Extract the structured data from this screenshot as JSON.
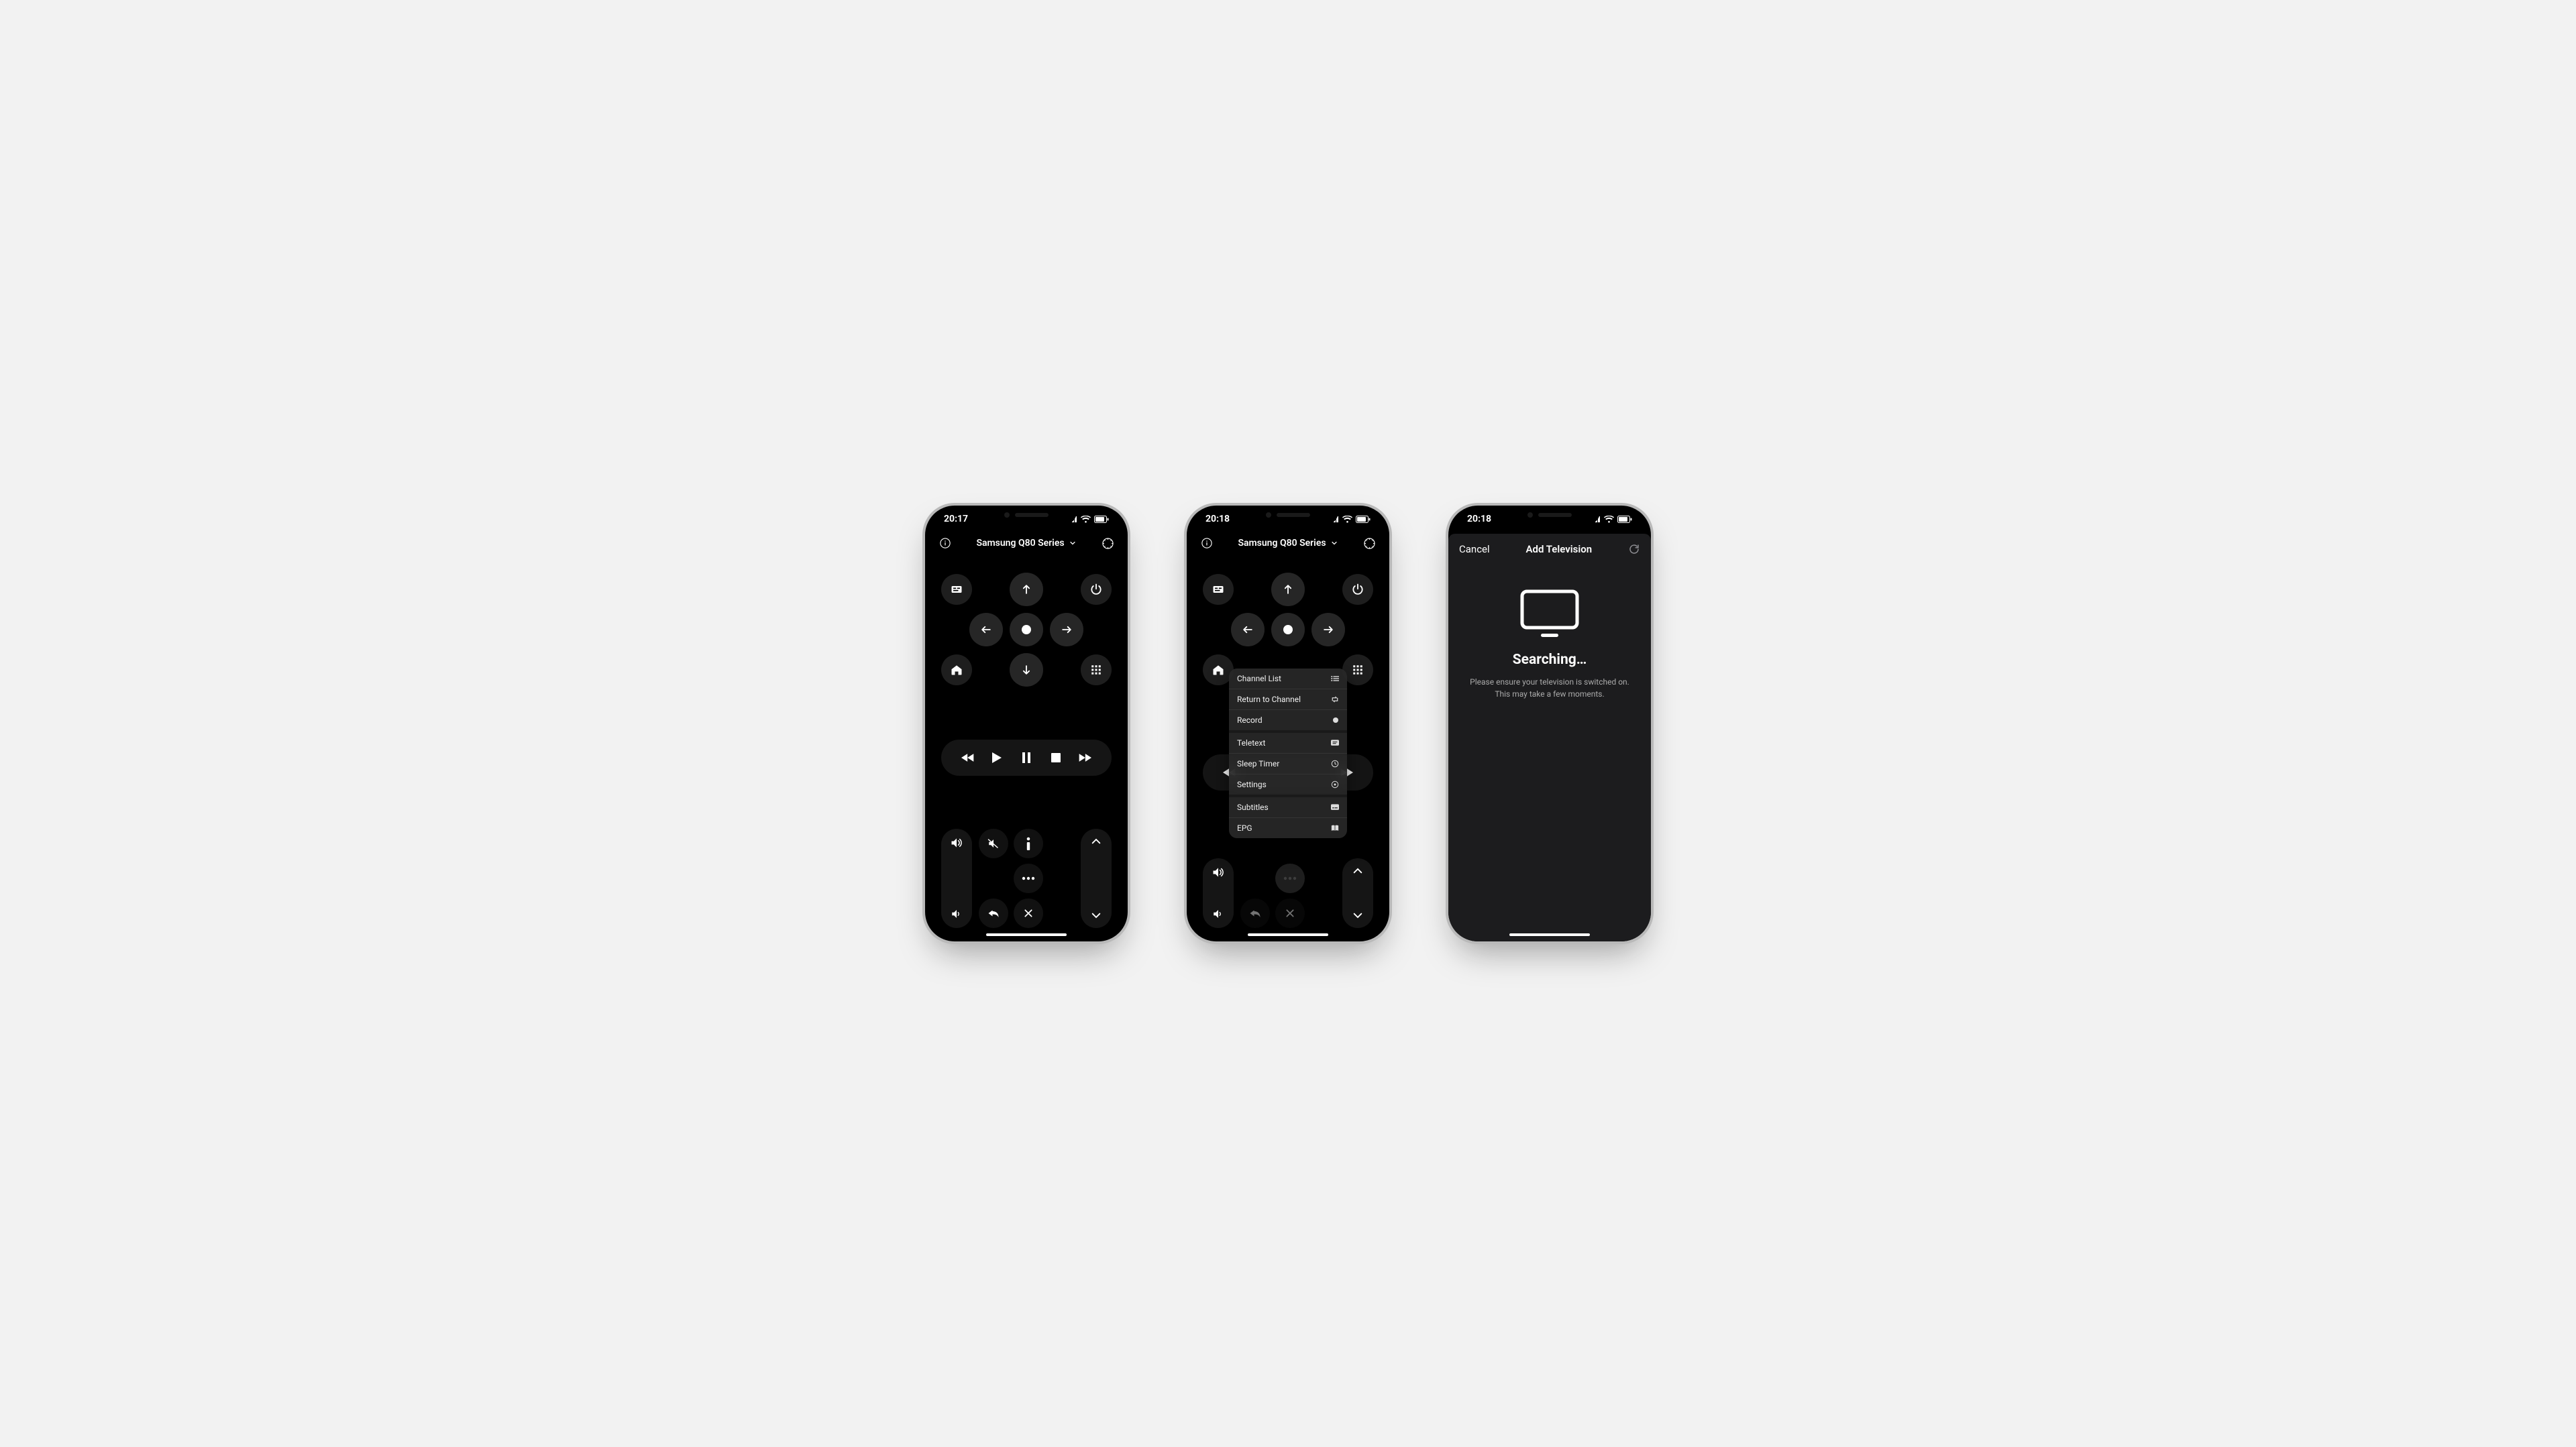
{
  "phones": [
    {
      "status_time": "20:17",
      "device_name": "Samsung Q80 Series",
      "menu_open": false
    },
    {
      "status_time": "20:18",
      "device_name": "Samsung Q80 Series",
      "menu_open": true,
      "menu": [
        {
          "label": "Channel List",
          "icon": "list-icon"
        },
        {
          "label": "Return to Channel",
          "icon": "swap-icon"
        },
        {
          "label": "Record",
          "icon": "record-dot-icon",
          "group_end": true
        },
        {
          "label": "Teletext",
          "icon": "teletext-icon"
        },
        {
          "label": "Sleep Timer",
          "icon": "clock-icon"
        },
        {
          "label": "Settings",
          "icon": "gear-icon",
          "group_end": true
        },
        {
          "label": "Subtitles",
          "icon": "subtitle-icon"
        },
        {
          "label": "EPG",
          "icon": "guide-icon"
        }
      ]
    },
    {
      "status_time": "20:18",
      "modal": {
        "cancel": "Cancel",
        "title": "Add Television",
        "heading": "Searching…",
        "description_line1": "Please ensure your television is switched on.",
        "description_line2": "This may take a few moments."
      }
    }
  ]
}
